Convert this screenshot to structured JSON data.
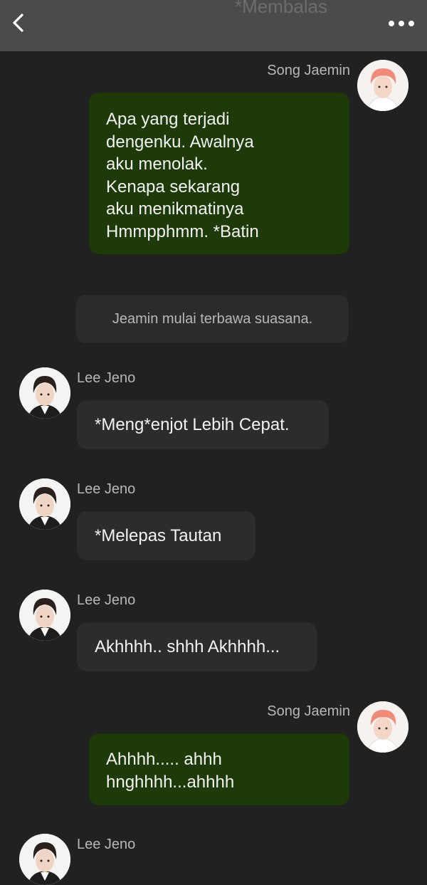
{
  "header": {
    "back_icon": "chevron-left-icon",
    "status_text": "*Membalas",
    "more_icon": "more-horizontal-icon"
  },
  "messages": [
    {
      "sender": "Song Jaemin",
      "side": "right",
      "text": "Apa yang terjadi\ndengenku. Awalnya\naku menolak.\nKenapa sekarang\naku menikmatinya\nHmmpphmm. *Batin"
    },
    {
      "narration": "Jeamin mulai terbawa suasana."
    },
    {
      "sender": "Lee Jeno",
      "side": "left",
      "text": "*Meng*enjot Lebih Cepat."
    },
    {
      "sender": "Lee Jeno",
      "side": "left",
      "text": "*Melepas Tautan"
    },
    {
      "sender": "Lee Jeno",
      "side": "left",
      "text": "Akhhhh.. shhh Akhhhh..."
    },
    {
      "sender": "Song Jaemin",
      "side": "right",
      "text": "Ahhhh..... ahhh\nhnghhhh...ahhhh"
    },
    {
      "sender": "Lee Jeno",
      "side": "left",
      "text": ""
    }
  ],
  "colors": {
    "background": "#212121",
    "header": "#4b4b4b",
    "bubble_self": "#1e3a09",
    "bubble_other": "#2c2c2c",
    "name_text": "#b7b7b7"
  }
}
